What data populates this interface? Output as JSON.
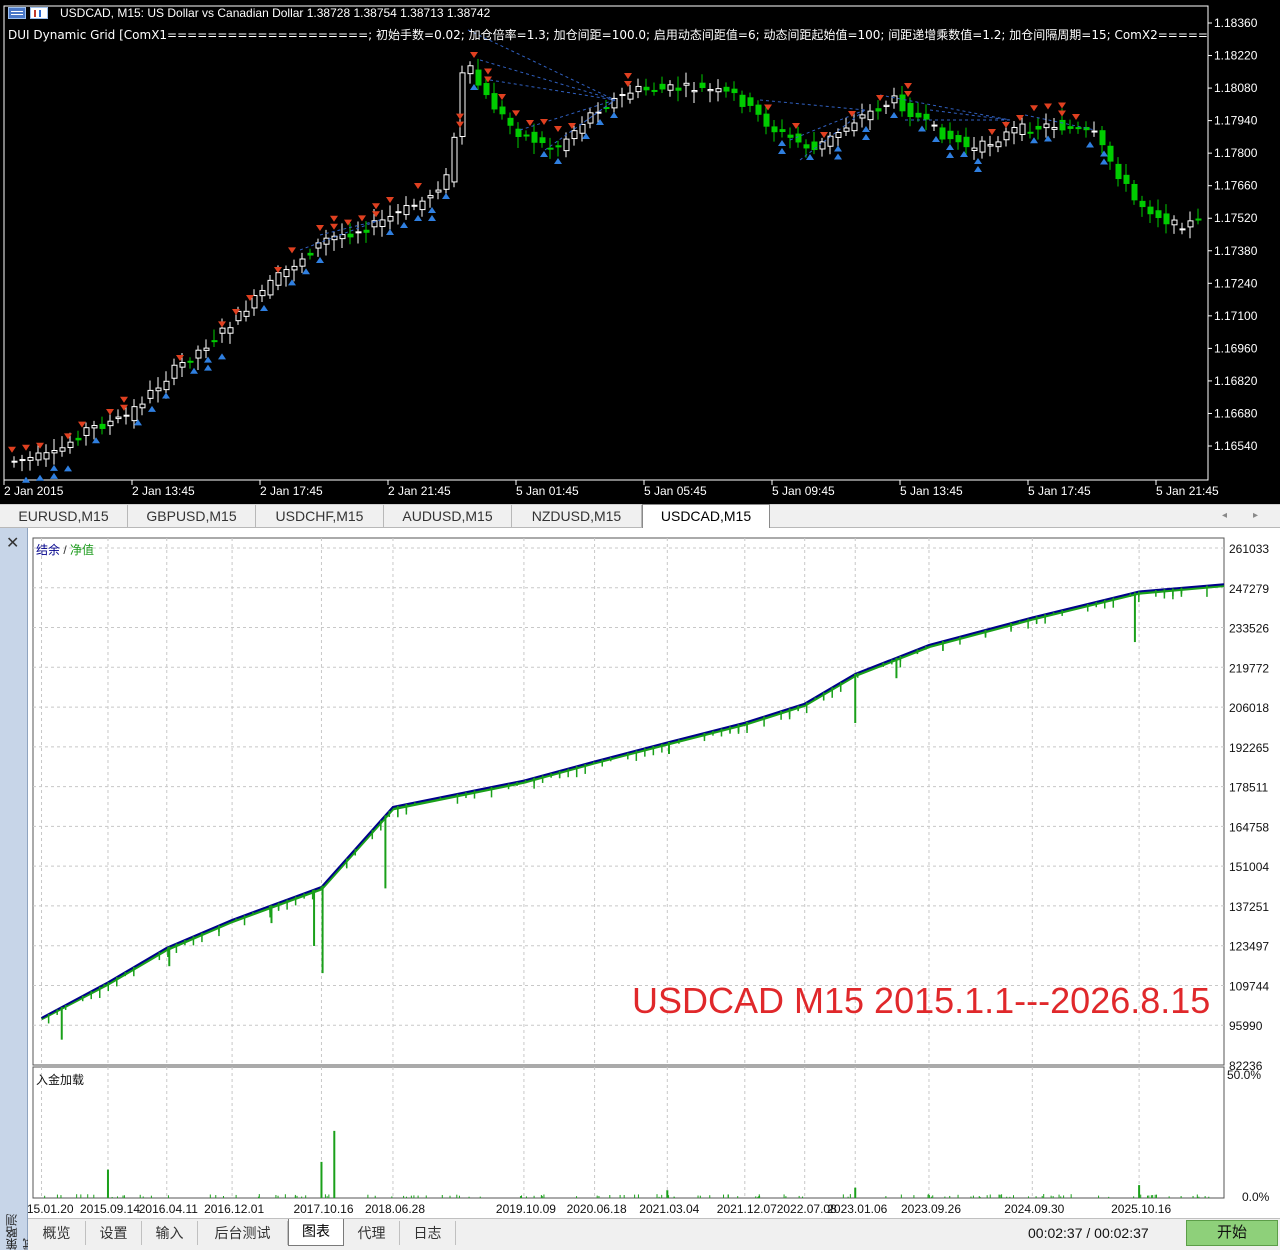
{
  "chart": {
    "header_text": "USDCAD, M15:  US Dollar vs Canadian Dollar  1.38728 1.38754 1.38713 1.38742",
    "indicator_text": "DUI Dynamic Grid [ComX1====================; 初始手数=0.02; 加仓倍率=1.3; 加仓间距=100.0; 启用动态间距值=6; 动态间距起始值=100; 间距递增乘数值=1.2; 加仓间隔周期=15; ComX2============",
    "price_levels": [
      "1.18360",
      "1.18220",
      "1.18080",
      "1.17940",
      "1.17800",
      "1.17660",
      "1.17520",
      "1.17380",
      "1.17240",
      "1.17100",
      "1.16960",
      "1.16820",
      "1.16680",
      "1.16540"
    ],
    "time_labels": [
      "2 Jan 2015",
      "2 Jan 13:45",
      "2 Jan 17:45",
      "2 Jan 21:45",
      "5 Jan 01:45",
      "5 Jan 05:45",
      "5 Jan 09:45",
      "5 Jan 13:45",
      "5 Jan 17:45",
      "5 Jan 21:45"
    ],
    "colors": {
      "background": "#000000",
      "bull": "#ffffff",
      "bear": "#00cc00",
      "sell_marker": "#e04020",
      "buy_marker": "#2f7fe0",
      "link_line": "#3060c0"
    }
  },
  "symbol_tabs": [
    {
      "label": "EURUSD,M15"
    },
    {
      "label": "GBPUSD,M15"
    },
    {
      "label": "USDCHF,M15"
    },
    {
      "label": "AUDUSD,M15"
    },
    {
      "label": "NZDUSD,M15"
    },
    {
      "label": "USDCAD,M15",
      "active": true
    }
  ],
  "tester": {
    "legend_balance": "结余",
    "legend_separator": " / ",
    "legend_equity": "净值",
    "overlay_title": "USDCAD M15 2015.1.1---2026.8.15",
    "load_label": "入金加载",
    "side_title": "策略测试",
    "load_levels": [
      "50.0%",
      "0.0%"
    ],
    "x_labels": [
      "2015.01.20",
      "2015.09.14",
      "2016.04.11",
      "2016.12.01",
      "2017.10.16",
      "2018.06.28",
      "2019.10.09",
      "2020.06.18",
      "2021.03.04",
      "2021.12.07",
      "2022.07.08",
      "2023.01.06",
      "2023.09.26",
      "2024.09.30",
      "2025.10.16"
    ],
    "colors": {
      "balance": "#00008b",
      "equity": "#1aa01a",
      "load": "#1aa01a",
      "grid": "#c8c8c8"
    }
  },
  "chart_data": {
    "type": "line",
    "title": "",
    "xlabel": "",
    "ylabel": "",
    "ylim": [
      82236,
      261033
    ],
    "y_ticks": [
      261033,
      247279,
      233526,
      219772,
      206018,
      192265,
      178511,
      164758,
      151004,
      137251,
      123497,
      109744,
      95990,
      82236
    ],
    "x": [
      "2015.01.20",
      "2015.09.14",
      "2016.04.11",
      "2016.12.01",
      "2017.10.16",
      "2018.06.28",
      "2019.10.09",
      "2020.06.18",
      "2021.03.04",
      "2021.12.07",
      "2022.07.08",
      "2023.01.06",
      "2023.09.26",
      "2024.09.30",
      "2025.10.16",
      "2026.08.15"
    ],
    "series": [
      {
        "name": "结余",
        "values": [
          98500,
          110800,
          122800,
          132400,
          143800,
          171500,
          180600,
          187200,
          193800,
          200600,
          207200,
          217500,
          227500,
          237000,
          246000,
          248500
        ]
      },
      {
        "name": "净值",
        "values": [
          98200,
          110200,
          122100,
          131800,
          143100,
          170800,
          180000,
          186700,
          193200,
          200000,
          206600,
          216900,
          226900,
          236400,
          245400,
          248000
        ]
      }
    ],
    "equity_dips": [
      {
        "x": "2015.04.01",
        "value": 91000
      },
      {
        "x": "2015.09.01",
        "value": 109200
      },
      {
        "x": "2016.04.20",
        "value": 116400
      },
      {
        "x": "2017.04.20",
        "value": 131300
      },
      {
        "x": "2017.09.20",
        "value": 123400
      },
      {
        "x": "2017.10.20",
        "value": 114000
      },
      {
        "x": "2018.06.01",
        "value": 143300
      },
      {
        "x": "2021.03.10",
        "value": 189800
      },
      {
        "x": "2023.01.06",
        "value": 200500
      },
      {
        "x": "2023.06.01",
        "value": 216000
      },
      {
        "x": "2025.10.01",
        "value": 228500
      }
    ],
    "load_spikes": [
      {
        "x": "2015.09.14",
        "value": 11
      },
      {
        "x": "2017.10.16",
        "value": 14
      },
      {
        "x": "2017.12.01",
        "value": 26
      },
      {
        "x": "2021.03.04",
        "value": 3
      },
      {
        "x": "2023.01.06",
        "value": 4
      },
      {
        "x": "2025.10.16",
        "value": 5
      }
    ]
  },
  "bottom_tabs": [
    {
      "label": "概览"
    },
    {
      "label": "设置"
    },
    {
      "label": "输入"
    },
    {
      "label": "后台测试"
    },
    {
      "label": "图表",
      "active": true
    },
    {
      "label": "代理"
    },
    {
      "label": "日志"
    }
  ],
  "status": {
    "timer": "00:02:37 / 00:02:37",
    "start_label": "开始"
  }
}
